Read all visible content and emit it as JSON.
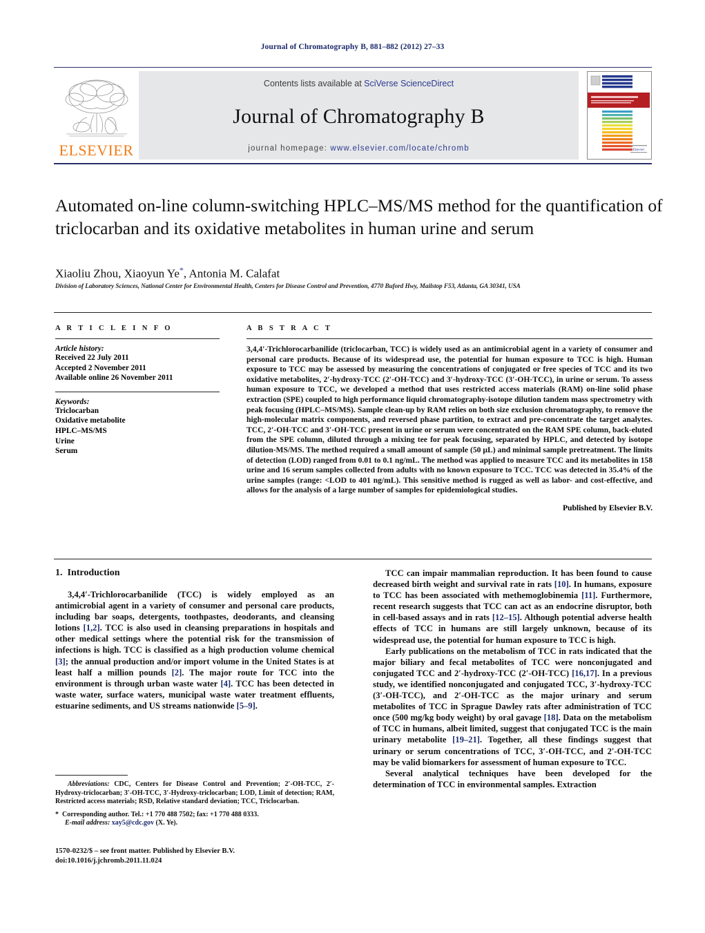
{
  "running_head": "Journal of Chromatography B, 881–882 (2012) 27–33",
  "masthead": {
    "contents_prefix": "Contents lists available at ",
    "sciencedirect": "SciVerse ScienceDirect",
    "journal_name": "Journal of Chromatography B",
    "homepage_prefix": "journal homepage: ",
    "homepage_url": "www.elsevier.com/locate/chromb",
    "publisher_logo_text": "ELSEVIER",
    "cover_title": "JOURNAL OF CHROMATOGRAPHY B",
    "accent_blue": "#2b3a8f",
    "accent_orange": "#f07d1b",
    "band_gray": "#e6e7e9",
    "cover_red": "#b51f24"
  },
  "article": {
    "title": "Automated on-line column-switching HPLC–MS/MS method for the quantification of triclocarban and its oxidative metabolites in human urine and serum",
    "authors": "Xiaoliu Zhou, Xiaoyun Ye",
    "authors_tail": ", Antonia M. Calafat",
    "corresponding_marker": "*",
    "affiliation": "Division of Laboratory Sciences, National Center for Environmental Health, Centers for Disease Control and Prevention, 4770 Buford Hwy, Mailstop F53, Atlanta, GA 30341, USA"
  },
  "article_info": {
    "heading": "A R T I C L E   I N F O",
    "history_label": "Article history:",
    "history": [
      "Received 22 July 2011",
      "Accepted 2 November 2011",
      "Available online 26 November 2011"
    ],
    "keywords_label": "Keywords:",
    "keywords": [
      "Triclocarban",
      "Oxidative metabolite",
      "HPLC–MS/MS",
      "Urine",
      "Serum"
    ]
  },
  "abstract": {
    "heading": "A B S T R A C T",
    "text": "3,4,4′-Trichlorocarbanilide (triclocarban, TCC) is widely used as an antimicrobial agent in a variety of consumer and personal care products. Because of its widespread use, the potential for human exposure to TCC is high. Human exposure to TCC may be assessed by measuring the concentrations of conjugated or free species of TCC and its two oxidative metabolites, 2′-hydroxy-TCC (2′-OH-TCC) and 3′-hydroxy-TCC (3′-OH-TCC), in urine or serum. To assess human exposure to TCC, we developed a method that uses restricted access materials (RAM) on-line solid phase extraction (SPE) coupled to high performance liquid chromatography-isotope dilution tandem mass spectrometry with peak focusing (HPLC–MS/MS). Sample clean-up by RAM relies on both size exclusion chromatography, to remove the high-molecular matrix components, and reversed phase partition, to extract and pre-concentrate the target analytes. TCC, 2′-OH-TCC and 3′-OH-TCC present in urine or serum were concentrated on the RAM SPE column, back-eluted from the SPE column, diluted through a mixing tee for peak focusing, separated by HPLC, and detected by isotope dilution-MS/MS. The method required a small amount of sample (50 μL) and minimal sample pretreatment. The limits of detection (LOD) ranged from 0.01 to 0.1 ng/mL. The method was applied to measure TCC and its metabolites in 158 urine and 16 serum samples collected from adults with no known exposure to TCC. TCC was detected in 35.4% of the urine samples (range: <LOD to 401 ng/mL). This sensitive method is rugged as well as labor- and cost-effective, and allows for the analysis of a large number of samples for epidemiological studies.",
    "publisher_line": "Published by Elsevier B.V."
  },
  "introduction": {
    "number": "1.",
    "heading": "Introduction",
    "left_paragraphs": [
      "3,4,4′-Trichlorocarbanilide (TCC) is widely employed as an antimicrobial agent in a variety of consumer and personal care products, including bar soaps, detergents, toothpastes, deodorants, and cleansing lotions [1,2]. TCC is also used in cleansing preparations in hospitals and other medical settings where the potential risk for the transmission of infections is high. TCC is classified as a high production volume chemical [3]; the annual production and/or import volume in the United States is at least half a million pounds [2]. The major route for TCC into the environment is through urban waste water [4]. TCC has been detected in waste water, surface waters, municipal waste water treatment effluents, estuarine sediments, and US streams nationwide [5–9]."
    ],
    "right_paragraphs": [
      "TCC can impair mammalian reproduction. It has been found to cause decreased birth weight and survival rate in rats [10]. In humans, exposure to TCC has been associated with methemoglobinemia [11]. Furthermore, recent research suggests that TCC can act as an endocrine disruptor, both in cell-based assays and in rats [12–15]. Although potential adverse health effects of TCC in humans are still largely unknown, because of its widespread use, the potential for human exposure to TCC is high.",
      "Early publications on the metabolism of TCC in rats indicated that the major biliary and fecal metabolites of TCC were nonconjugated and conjugated TCC and 2′-hydroxy-TCC (2′-OH-TCC) [16,17]. In a previous study, we identified nonconjugated and conjugated TCC, 3′-hydroxy-TCC (3′-OH-TCC), and 2′-OH-TCC as the major urinary and serum metabolites of TCC in Sprague Dawley rats after administration of TCC once (500 mg/kg body weight) by oral gavage [18]. Data on the metabolism of TCC in humans, albeit limited, suggest that conjugated TCC is the main urinary metabolite [19–21]. Together, all these findings suggest that urinary or serum concentrations of TCC, 3′-OH-TCC, and 2′-OH-TCC may be valid biomarkers for assessment of human exposure to TCC.",
      "Several analytical techniques have been developed for the determination of TCC in environmental samples. Extraction"
    ]
  },
  "footnotes": {
    "abbreviations_label": "Abbreviations:",
    "abbreviations_text": " CDC, Centers for Disease Control and Prevention; 2′-OH-TCC, 2′-Hydroxy-triclocarban; 3′-OH-TCC, 3′-Hydroxy-triclocarban; LOD, Limit of detection; RAM, Restricted access materials; RSD, Relative standard deviation; TCC, Triclocarban.",
    "corresponding_bullet": "*",
    "corresponding_text": "Corresponding author. Tel.: +1 770 488 7502; fax: +1 770 488 0333.",
    "email_label": "E-mail address:",
    "email": "xay5@cdc.gov",
    "email_suffix": " (X. Ye)."
  },
  "imprint": {
    "line1": "1570-0232/$ – see front matter. Published by Elsevier B.V.",
    "line2": "doi:10.1016/j.jchromb.2011.11.024"
  }
}
